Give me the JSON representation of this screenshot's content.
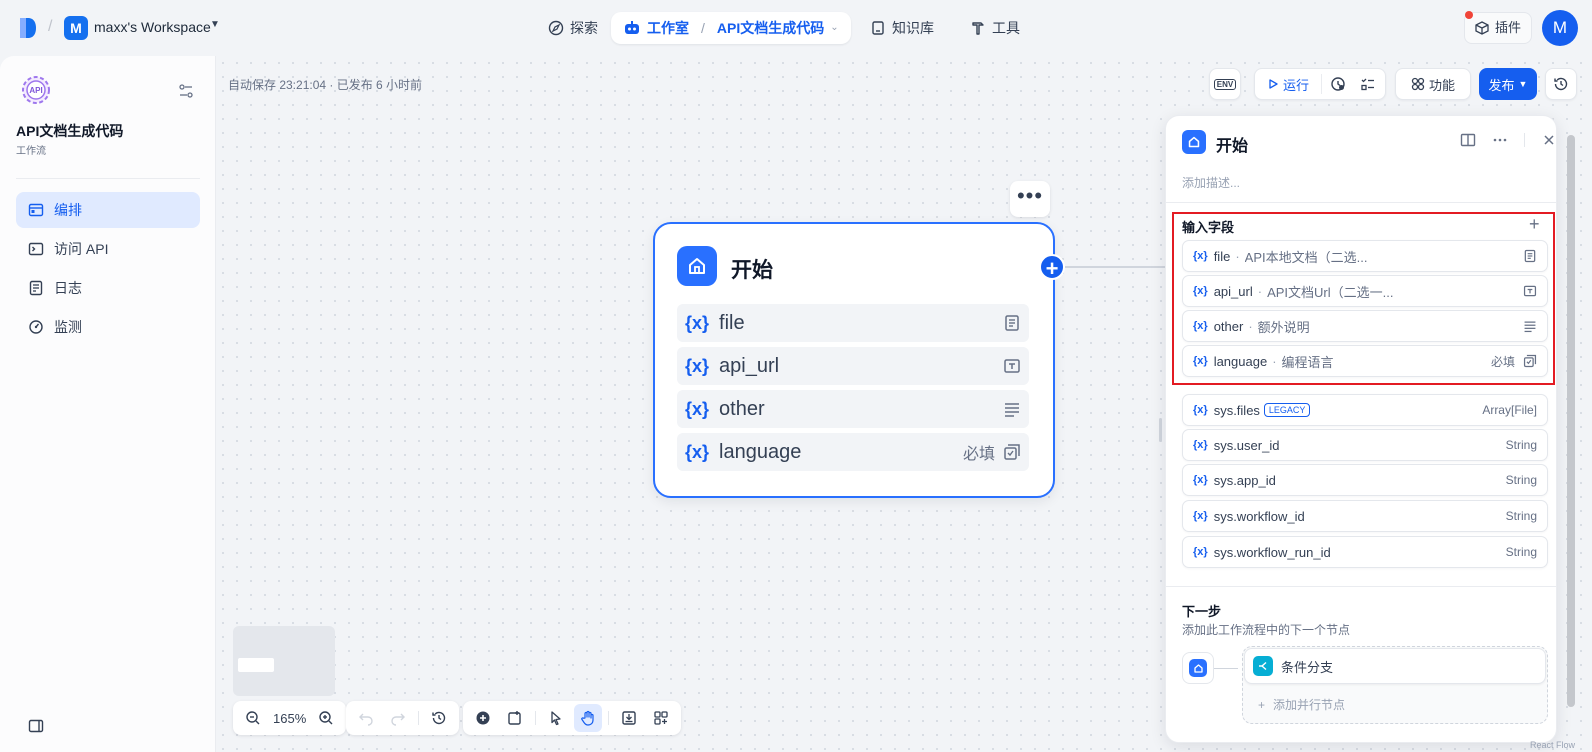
{
  "topbar": {
    "workspace_initial": "M",
    "workspace_name": "maxx's Workspace",
    "nav": {
      "explore": "探索",
      "studio": "工作室",
      "app": "API文档生成代码",
      "knowledge": "知识库",
      "tools": "工具"
    },
    "plugins": "插件",
    "user_initial": "M"
  },
  "sidebar": {
    "app_icon_text": "API",
    "app_name": "API文档生成代码",
    "app_type": "工作流",
    "items": [
      {
        "label": "编排",
        "icon": "orchestrate-icon"
      },
      {
        "label": "访问 API",
        "icon": "terminal-icon"
      },
      {
        "label": "日志",
        "icon": "log-icon"
      },
      {
        "label": "监测",
        "icon": "monitor-icon"
      }
    ]
  },
  "canvas": {
    "autosave": "自动保存 23:21:04 · 已发布 6 小时前",
    "toolbar": {
      "env": "ENV",
      "run": "运行",
      "features": "功能",
      "publish": "发布"
    },
    "node": {
      "title": "开始",
      "vars": [
        {
          "name": "file",
          "required": ""
        },
        {
          "name": "api_url",
          "required": ""
        },
        {
          "name": "other",
          "required": ""
        },
        {
          "name": "language",
          "required": "必填"
        }
      ]
    },
    "zoom": "165%"
  },
  "panel": {
    "title": "开始",
    "description_placeholder": "添加描述...",
    "input_fields_title": "输入字段",
    "input_vars": [
      {
        "name": "file",
        "label": "API本地文档（二选...",
        "required": ""
      },
      {
        "name": "api_url",
        "label": "API文档Url（二选一...",
        "required": ""
      },
      {
        "name": "other",
        "label": "额外说明",
        "required": ""
      },
      {
        "name": "language",
        "label": "编程语言",
        "required": "必填"
      }
    ],
    "sys_vars": [
      {
        "name": "sys.files",
        "badge": "LEGACY",
        "type": "Array[File]"
      },
      {
        "name": "sys.user_id",
        "badge": "",
        "type": "String"
      },
      {
        "name": "sys.app_id",
        "badge": "",
        "type": "String"
      },
      {
        "name": "sys.workflow_id",
        "badge": "",
        "type": "String"
      },
      {
        "name": "sys.workflow_run_id",
        "badge": "",
        "type": "String"
      }
    ],
    "next_step": {
      "title": "下一步",
      "description": "添加此工作流程中的下一个节点",
      "node": "条件分支",
      "add_parallel": "添加并行节点"
    }
  },
  "watermark": "React Flow",
  "colors": {
    "accent": "#155eef",
    "node_border": "#2970ff",
    "highlight": "#e31b23"
  }
}
